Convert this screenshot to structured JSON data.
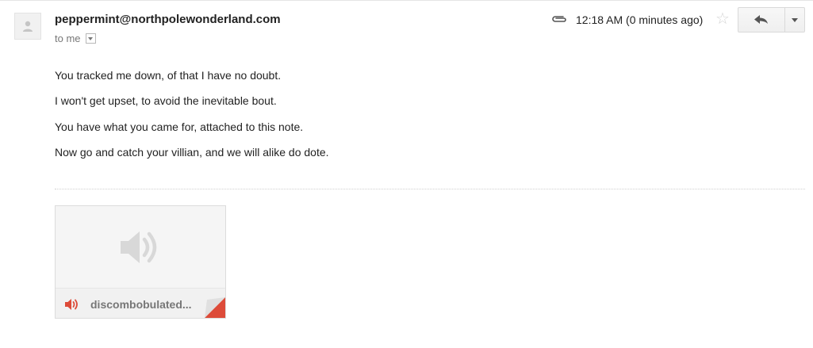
{
  "message": {
    "sender": "peppermint@northpolewonderland.com",
    "recipient_line": "to me",
    "timestamp": "12:18 AM (0 minutes ago)"
  },
  "body_lines": [
    "You tracked me down, of that I have no doubt.",
    "I won't get upset, to avoid the inevitable bout.",
    "You have what you came for, attached to this note.",
    "Now go and catch your villian, and we will alike do dote."
  ],
  "attachment": {
    "name": "discombobulated...",
    "type_icon": "audio-icon"
  },
  "icons": {
    "avatar": "person-icon",
    "attachment_indicator": "paperclip-icon",
    "star": "star-icon",
    "reply": "reply-icon",
    "more": "chevron-down-icon"
  },
  "colors": {
    "attachment_accent": "#dd4b39",
    "star": "#d4d4d4"
  }
}
